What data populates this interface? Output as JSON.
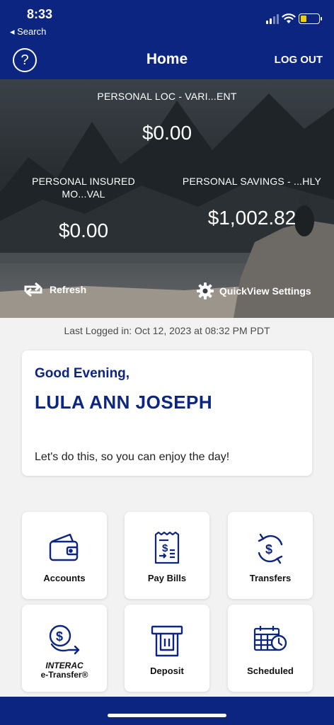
{
  "status": {
    "time": "8:33",
    "back_label": "◂ Search",
    "battery_color": "#f5d000"
  },
  "nav": {
    "help_glyph": "?",
    "title": "Home",
    "logout_label": "LOG OUT"
  },
  "hero": {
    "accounts": [
      {
        "name": "PERSONAL LOC - VARI...ENT",
        "balance": "$0.00"
      },
      {
        "name_line1": "PERSONAL INSURED",
        "name_line2": "MO...VAL",
        "balance": "$0.00"
      },
      {
        "name": "PERSONAL SAVINGS - ...HLY",
        "balance": "$1,002.82"
      }
    ],
    "refresh_label": "Refresh",
    "quickview_label": "QuickView Settings"
  },
  "last_logged": "Last Logged in: Oct 12, 2023 at 08:32 PM  PDT",
  "greeting": {
    "salutation": "Good Evening,",
    "name": "LULA ANN JOSEPH",
    "message": "Let's do this, so you can enjoy the day!"
  },
  "tiles": [
    {
      "label": "Accounts",
      "icon": "wallet-icon"
    },
    {
      "label": "Pay Bills",
      "icon": "bill-icon"
    },
    {
      "label": "Transfers",
      "icon": "transfer-icon"
    },
    {
      "label_line1": "INTERAC",
      "label_line2": "e-Transfer®",
      "icon": "etransfer-icon"
    },
    {
      "label": "Deposit",
      "icon": "atm-deposit-icon"
    },
    {
      "label": "Scheduled",
      "icon": "calendar-clock-icon"
    }
  ],
  "colors": {
    "brand_navy": "#0b2580",
    "background": "#f2f2f2"
  }
}
